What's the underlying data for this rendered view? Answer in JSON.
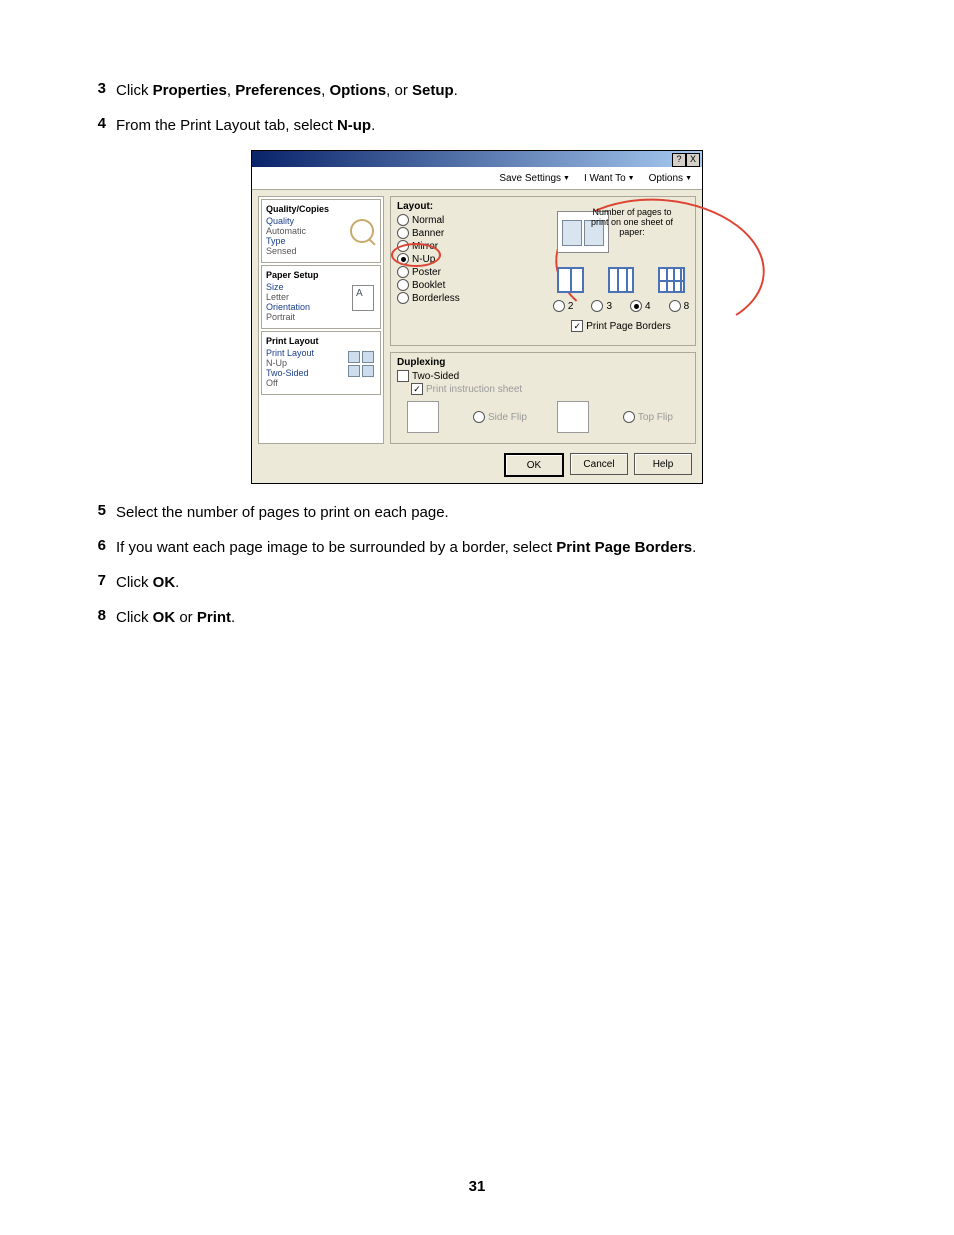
{
  "steps": {
    "s3": {
      "num": "3",
      "pre": "Click ",
      "b1": "Properties",
      "sep1": ", ",
      "b2": "Preferences",
      "sep2": ", ",
      "b3": "Options",
      "sep3": ", or ",
      "b4": "Setup",
      "post": "."
    },
    "s4": {
      "num": "4",
      "pre": "From the Print Layout tab, select ",
      "b1": "N-up",
      "post": "."
    },
    "s5": {
      "num": "5",
      "text": "Select the number of pages to print on each page."
    },
    "s6": {
      "num": "6",
      "pre": "If you want each page image to be surrounded by a border, select ",
      "b1": "Print Page Borders",
      "post": "."
    },
    "s7": {
      "num": "7",
      "pre": "Click ",
      "b1": "OK",
      "post": "."
    },
    "s8": {
      "num": "8",
      "pre": "Click ",
      "b1": "OK",
      "mid": " or ",
      "b2": "Print",
      "post": "."
    }
  },
  "dialog": {
    "title_help": "?",
    "title_close": "X",
    "topbar": {
      "save": "Save Settings",
      "iwant": "I Want To",
      "options": "Options"
    },
    "sidebar": {
      "qc": {
        "heading": "Quality/Copies",
        "l1": "Quality",
        "v1": "Automatic",
        "l2": "Type",
        "v2": "Sensed"
      },
      "ps": {
        "heading": "Paper Setup",
        "l1": "Size",
        "v1": "Letter",
        "l2": "Orientation",
        "v2": "Portrait"
      },
      "pl": {
        "heading": "Print Layout",
        "l1": "Print Layout",
        "v1": "N-Up",
        "l2": "Two-Sided",
        "v2": "Off"
      }
    },
    "layout": {
      "title": "Layout:",
      "r1": "Normal",
      "r2": "Banner",
      "r3": "Mirror",
      "r4": "N-Up",
      "r5": "Poster",
      "r6": "Booklet",
      "r7": "Borderless",
      "note": "Number of pages to print on one sheet of paper:",
      "n2": "2",
      "n3": "3",
      "n4": "4",
      "n8": "8",
      "ppb": "Print Page Borders"
    },
    "duplex": {
      "title": "Duplexing",
      "two": "Two-Sided",
      "instr": "Print instruction sheet",
      "side": "Side Flip",
      "top": "Top Flip"
    },
    "buttons": {
      "ok": "OK",
      "cancel": "Cancel",
      "help": "Help"
    }
  },
  "chart_data": {
    "type": "table",
    "title": "Printing Preferences — Print Layout tab",
    "layout_options": [
      "Normal",
      "Banner",
      "Mirror",
      "N-Up",
      "Poster",
      "Booklet",
      "Borderless"
    ],
    "layout_selected": "N-Up",
    "nup_choices": [
      2,
      3,
      4,
      8
    ],
    "nup_selected": 4,
    "print_page_borders": true,
    "duplex_two_sided": false,
    "duplex_instruction_sheet": true,
    "duplex_flip_options": [
      "Side Flip",
      "Top Flip"
    ]
  },
  "page_number": "31"
}
